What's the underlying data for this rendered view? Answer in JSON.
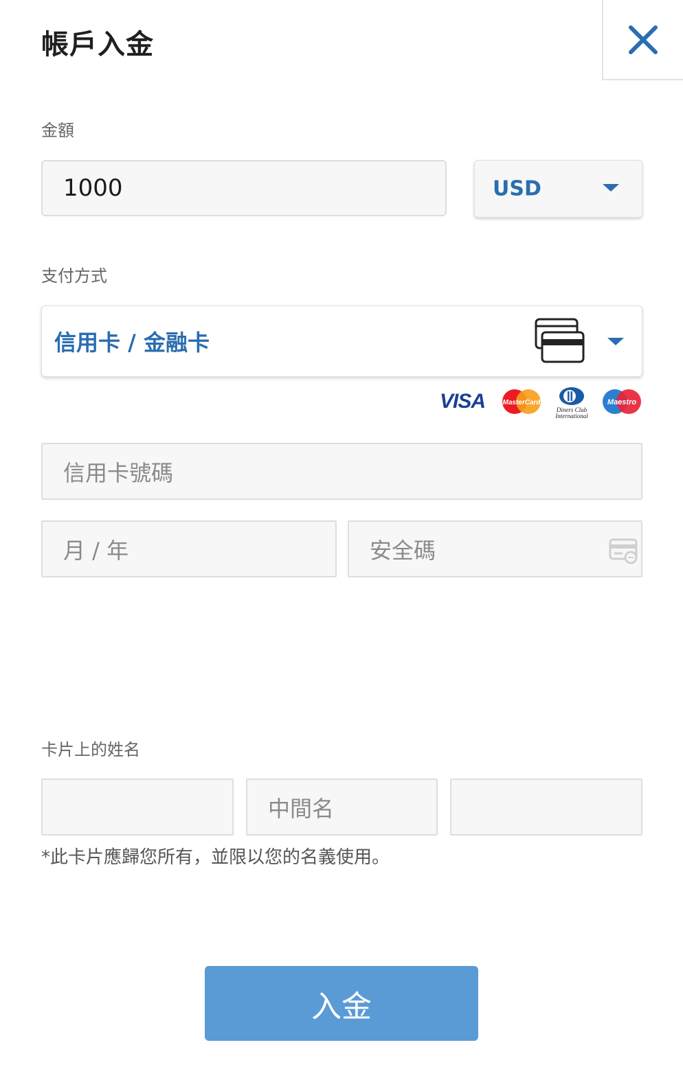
{
  "header": {
    "title": "帳戶入金",
    "close_icon": "close-icon"
  },
  "amount": {
    "label": "金額",
    "value": "1000",
    "currency": "USD"
  },
  "payment": {
    "label": "支付方式",
    "method": "信用卡 / 金融卡",
    "brands": [
      "VISA",
      "MasterCard",
      "Diners Club International",
      "Maestro"
    ]
  },
  "card": {
    "number_placeholder": "信用卡號碼",
    "expiry_placeholder": "月 / 年",
    "cvv_placeholder": "安全碼"
  },
  "name": {
    "label": "卡片上的姓名",
    "first_placeholder": "",
    "middle_placeholder": "中間名",
    "last_placeholder": "",
    "note": "*此卡片應歸您所有，並限以您的名義使用。"
  },
  "submit": {
    "label": "入金"
  },
  "colors": {
    "accent": "#2a6db0",
    "button": "#5a9bd6",
    "field_bg": "#f7f7f7",
    "border": "#dedede"
  }
}
